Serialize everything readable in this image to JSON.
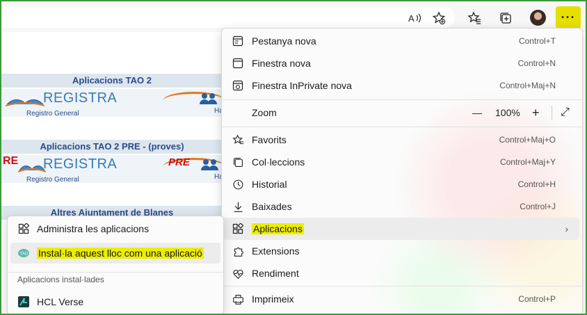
{
  "toolbar": {
    "icons": [
      "read-aloud-icon",
      "add-favorite-icon",
      "favorites-icon",
      "collections-icon",
      "profile-avatar",
      "more-icon"
    ],
    "read_aloud_glyph": "A",
    "more_glyph": "···"
  },
  "page": {
    "sections": [
      {
        "title": "Aplicacions TAO 2",
        "logo_text": "REGISTRA",
        "caption": "Registro General",
        "side_text": "Ha"
      },
      {
        "title": "Aplicacions TAO 2 PRE - (proves)",
        "logo_text": "REGISTRA",
        "caption": "Registro General",
        "side_text": "Ha",
        "pre_label": "RE",
        "pre2_label": "PRE"
      },
      {
        "title": "Altres Ajuntament de Blanes"
      }
    ]
  },
  "menu": {
    "items": [
      {
        "label": "Pestanya nova",
        "shortcut": "Control+T",
        "icon": "new-tab-icon"
      },
      {
        "label": "Finestra nova",
        "shortcut": "Control+N",
        "icon": "new-window-icon"
      },
      {
        "label": "Finestra InPrivate nova",
        "shortcut": "Control+Maj+N",
        "icon": "inprivate-icon"
      },
      {
        "label": "Zoom",
        "icon": "none"
      },
      {
        "label": "Favorits",
        "shortcut": "Control+Maj+O",
        "icon": "favorites-icon"
      },
      {
        "label": "Col·leccions",
        "shortcut": "Control+Maj+Y",
        "icon": "collections-icon"
      },
      {
        "label": "Historial",
        "shortcut": "Control+H",
        "icon": "history-icon"
      },
      {
        "label": "Baixades",
        "shortcut": "Control+J",
        "icon": "downloads-icon"
      },
      {
        "label": "Aplicacions",
        "icon": "apps-icon"
      },
      {
        "label": "Extensions",
        "icon": "extensions-icon"
      },
      {
        "label": "Rendiment",
        "icon": "performance-icon"
      },
      {
        "label": "Imprimeix",
        "shortcut": "Control+P",
        "icon": "print-icon"
      }
    ],
    "zoom": {
      "minus": "—",
      "value": "100%",
      "plus": "+",
      "fullscreen": "⤢"
    }
  },
  "submenu": {
    "items": [
      {
        "label": "Administra les aplicacions",
        "icon": "manage-apps-icon"
      },
      {
        "label": "Instal·la aquest lloc com una aplicació",
        "icon": "tao-app-icon"
      }
    ],
    "heading": "Aplicacions instal·lades",
    "installed": [
      {
        "label": "HCL Verse",
        "icon": "hcl-verse-icon"
      }
    ]
  },
  "colors": {
    "highlight": "#eded00",
    "frame": "#3b9b3b",
    "header_text": "#2a4a8a"
  }
}
